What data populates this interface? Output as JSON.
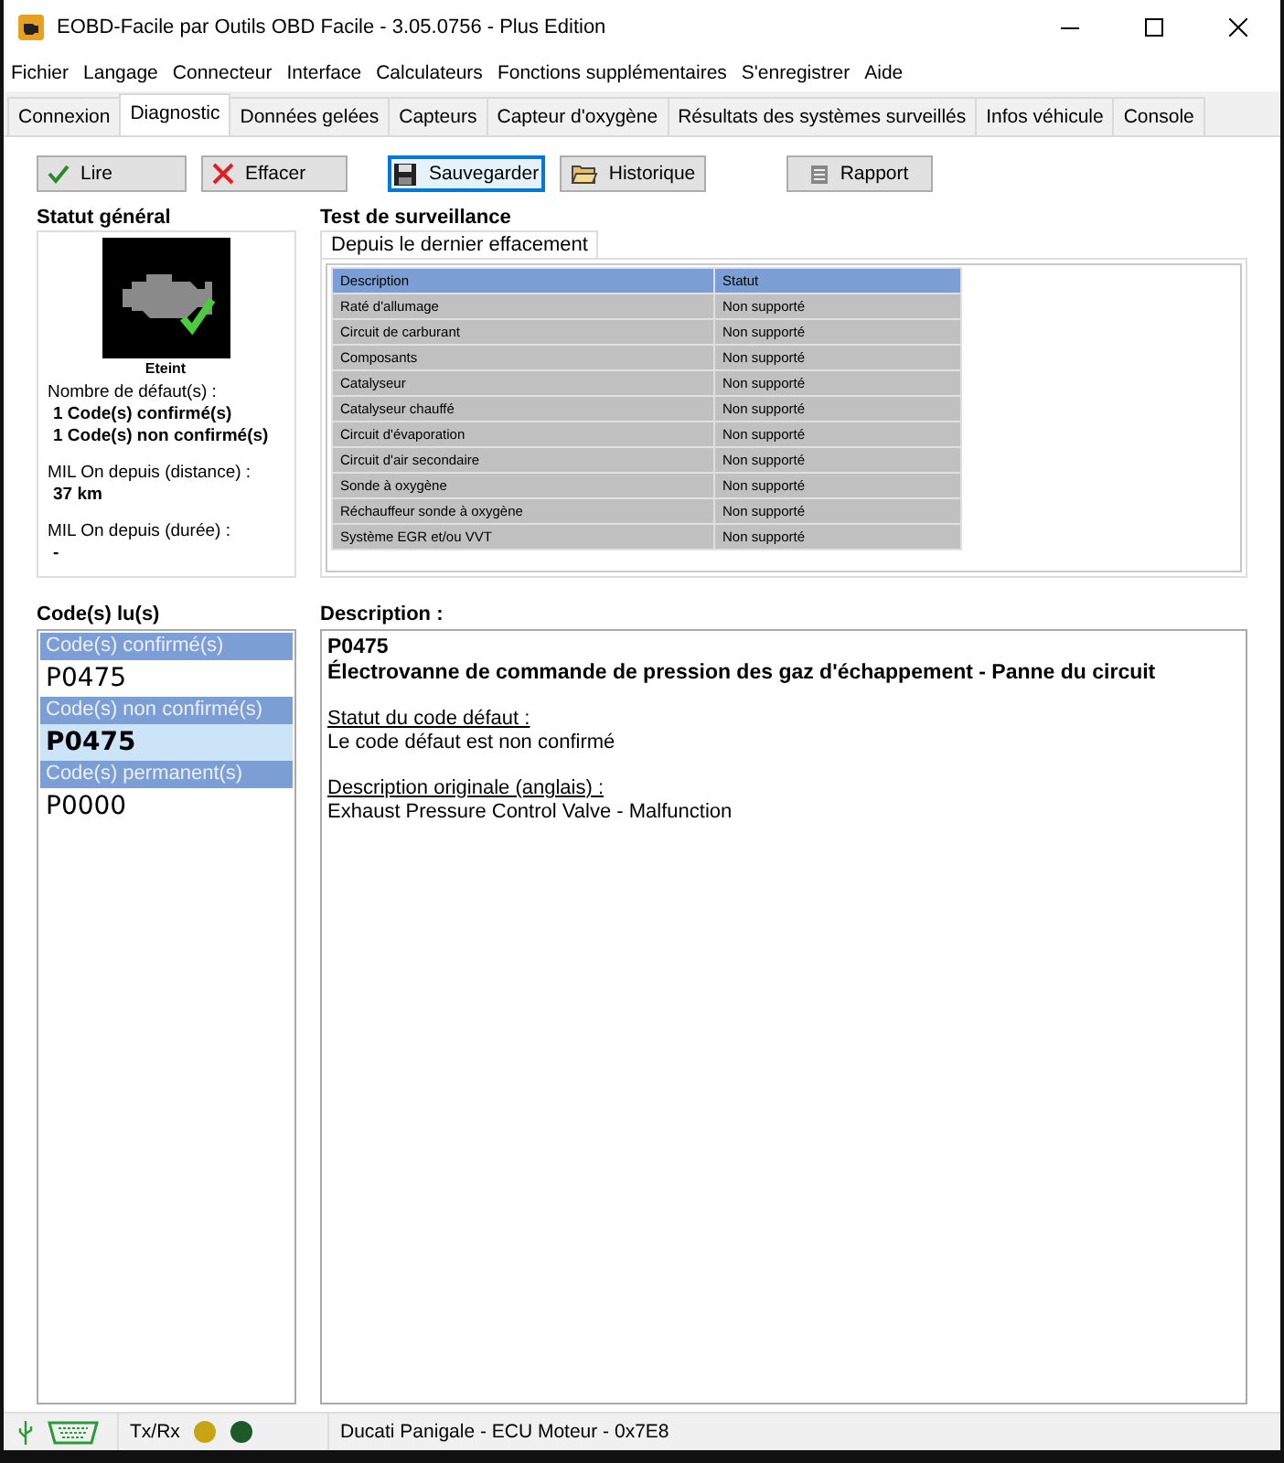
{
  "window": {
    "title": "EOBD-Facile par Outils OBD Facile - 3.05.0756 - Plus Edition"
  },
  "menu": [
    "Fichier",
    "Langage",
    "Connecteur",
    "Interface",
    "Calculateurs",
    "Fonctions supplémentaires",
    "S'enregistrer",
    "Aide"
  ],
  "tabs": [
    {
      "label": "Connexion",
      "selected": false
    },
    {
      "label": "Diagnostic",
      "selected": true
    },
    {
      "label": "Données gelées",
      "selected": false
    },
    {
      "label": "Capteurs",
      "selected": false
    },
    {
      "label": "Capteur d'oxygène",
      "selected": false
    },
    {
      "label": "Résultats des systèmes surveillés",
      "selected": false
    },
    {
      "label": "Infos véhicule",
      "selected": false
    },
    {
      "label": "Console",
      "selected": false
    }
  ],
  "toolbar": [
    {
      "label": "Lire",
      "kind": "check",
      "focused": false
    },
    {
      "label": "Effacer",
      "kind": "cross",
      "focused": false
    },
    {
      "label": "Sauvegarder",
      "kind": "save",
      "focused": true
    },
    {
      "label": "Historique",
      "kind": "folder",
      "focused": false
    },
    {
      "label": "Rapport",
      "kind": "report",
      "focused": false
    }
  ],
  "general_status": {
    "heading": "Statut général",
    "mil_label": "Eteint",
    "blocks": [
      {
        "lines": [
          {
            "text": "Nombre de défaut(s) :",
            "bold": false
          },
          {
            "text": "1 Code(s) confirmé(s)",
            "bold": true
          },
          {
            "text": "1 Code(s) non confirmé(s)",
            "bold": true
          }
        ]
      },
      {
        "lines": [
          {
            "text": "MIL On depuis (distance) :",
            "bold": false
          },
          {
            "text": "37 km",
            "bold": true
          }
        ]
      },
      {
        "lines": [
          {
            "text": "MIL On depuis (durée) :",
            "bold": false
          },
          {
            "text": "-",
            "bold": true
          }
        ]
      }
    ]
  },
  "monitoring": {
    "heading": "Test de surveillance",
    "tab": "Depuis le dernier effacement",
    "columns": [
      "Description",
      "Statut"
    ],
    "rows": [
      [
        "Raté d'allumage",
        "Non supporté"
      ],
      [
        "Circuit de carburant",
        "Non supporté"
      ],
      [
        "Composants",
        "Non supporté"
      ],
      [
        "Catalyseur",
        "Non supporté"
      ],
      [
        "Catalyseur chauffé",
        "Non supporté"
      ],
      [
        "Circuit d'évaporation",
        "Non supporté"
      ],
      [
        "Circuit d'air secondaire",
        "Non supporté"
      ],
      [
        "Sonde à oxygène",
        "Non supporté"
      ],
      [
        "Réchauffeur sonde à oxygène",
        "Non supporté"
      ],
      [
        "Système EGR et/ou VVT",
        "Non supporté"
      ]
    ]
  },
  "codes": {
    "heading": "Code(s) lu(s)",
    "groups": [
      {
        "header": "Code(s) confirmé(s)",
        "items": [
          {
            "code": "P0475",
            "selected": false
          }
        ]
      },
      {
        "header": "Code(s) non confirmé(s)",
        "items": [
          {
            "code": "P0475",
            "selected": true
          }
        ]
      },
      {
        "header": "Code(s) permanent(s)",
        "items": [
          {
            "code": "P0000",
            "selected": false
          }
        ]
      }
    ]
  },
  "description": {
    "heading": "Description :",
    "code": "P0475",
    "title": "Électrovanne de commande de pression des gaz d'échappement - Panne du circuit",
    "sections": [
      {
        "heading": "Statut du code défaut :",
        "text": "Le code défaut est non confirmé"
      },
      {
        "heading": "Description originale (anglais) :",
        "text": "Exhaust Pressure Control Valve - Malfunction"
      }
    ]
  },
  "status_bar": {
    "traffic_label": "Tx/Rx",
    "leds": [
      {
        "color": "#c8a414"
      },
      {
        "color": "#1c5a2c"
      }
    ],
    "vehicle": "Ducati Panigale - ECU Moteur - 0x7E8"
  }
}
